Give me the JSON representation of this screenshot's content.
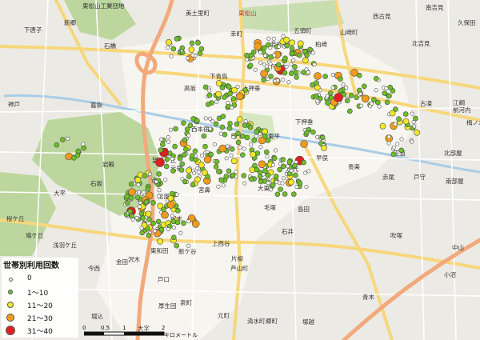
{
  "legend": {
    "title": "世帯別利用回数",
    "classes": [
      {
        "label": "0",
        "color": "#ffffff"
      },
      {
        "label": "1〜10",
        "color": "#6cbf26"
      },
      {
        "label": "11〜20",
        "color": "#f2e829"
      },
      {
        "label": "21〜30",
        "color": "#f29a1d"
      },
      {
        "label": "31〜40",
        "color": "#e02020"
      }
    ]
  },
  "scale": {
    "ticks": [
      "0",
      "0.5",
      "1",
      "2"
    ],
    "unit": "キロメートル"
  },
  "colors": {
    "background": "#eceae4",
    "urban": "#f7f5ef",
    "forest": "#bcd69e",
    "park": "#d6e8c2",
    "expressway": "#f2a97c",
    "main_road": "#f7d77c"
  },
  "places": [
    {
      "name": "東松山工業団地"
    },
    {
      "name": "東松山"
    },
    {
      "name": "美土里町"
    },
    {
      "name": "西古見"
    },
    {
      "name": "南吉見"
    },
    {
      "name": "久保田"
    },
    {
      "name": "新郷"
    },
    {
      "name": "下唐子"
    },
    {
      "name": "幸町"
    },
    {
      "name": "五領町"
    },
    {
      "name": "山崎町"
    },
    {
      "name": "北吉見"
    },
    {
      "name": "石橋"
    },
    {
      "name": "若松町"
    },
    {
      "name": "柏崎"
    },
    {
      "name": "上野本"
    },
    {
      "name": "下野本"
    },
    {
      "name": "下青鳥"
    },
    {
      "name": "高坂"
    },
    {
      "name": "上押垂"
    },
    {
      "name": "古凍"
    },
    {
      "name": "江綱"
    },
    {
      "name": "前河内"
    },
    {
      "name": "神戸"
    },
    {
      "name": "葛袋"
    },
    {
      "name": "梅ノ木"
    },
    {
      "name": "西本宿"
    },
    {
      "name": "下押垂"
    },
    {
      "name": "高坂"
    },
    {
      "name": "東平"
    },
    {
      "name": "正直"
    },
    {
      "name": "岩殿"
    },
    {
      "name": "早俣"
    },
    {
      "name": "北部屋"
    },
    {
      "name": "石坂"
    },
    {
      "name": "望見ヶ丘"
    },
    {
      "name": "元宿"
    },
    {
      "name": "正代"
    },
    {
      "name": "長楽"
    },
    {
      "name": "大谷"
    },
    {
      "name": "赤尾"
    },
    {
      "name": "戸守"
    },
    {
      "name": "南部屋"
    },
    {
      "name": "大平"
    },
    {
      "name": "松風台"
    },
    {
      "name": "毛塚"
    },
    {
      "name": "島田"
    },
    {
      "name": "宮鼻"
    },
    {
      "name": "桜ケ丘"
    },
    {
      "name": "田木"
    },
    {
      "name": "大東"
    },
    {
      "name": "石井"
    },
    {
      "name": "鳩ケ丘"
    },
    {
      "name": "上西谷"
    },
    {
      "name": "吹塚"
    },
    {
      "name": "浅羽ケ丘"
    },
    {
      "name": "中山"
    },
    {
      "name": "東和田"
    },
    {
      "name": "沢木"
    },
    {
      "name": "新ケ谷"
    },
    {
      "name": "片柳"
    },
    {
      "name": "芦山町"
    },
    {
      "name": "金田"
    },
    {
      "name": "今西"
    },
    {
      "name": "小沼"
    },
    {
      "name": "戸口"
    },
    {
      "name": "青木"
    },
    {
      "name": "泉町"
    },
    {
      "name": "厚生団"
    },
    {
      "name": "元町"
    },
    {
      "name": "清水町"
    },
    {
      "name": "堀込"
    },
    {
      "name": "郷町"
    },
    {
      "name": "大字"
    },
    {
      "name": "塚越"
    }
  ]
}
